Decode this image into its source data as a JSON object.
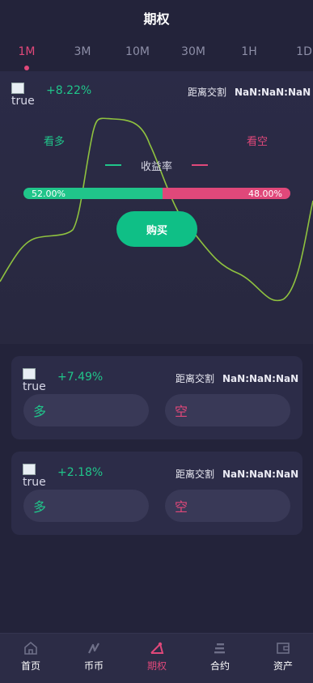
{
  "header": {
    "title": "期权"
  },
  "tabs": {
    "items": [
      "1M",
      "3M",
      "10M",
      "30M",
      "1H",
      "1D"
    ],
    "active": "1M"
  },
  "hero": {
    "image_alt": "true",
    "change": "+8.22%",
    "countdown_label": "距离交割",
    "countdown_value": "NaN:NaN:NaN",
    "long_label": "看多",
    "short_label": "看空",
    "yield_label": "收益率",
    "long_ratio": 0.52,
    "long_pct": "52.00%",
    "short_pct": "48.00%",
    "buy_label": "购买"
  },
  "cards": [
    {
      "image_alt": "true",
      "change": "+7.49%",
      "countdown_label": "距离交割",
      "countdown_value": "NaN:NaN:NaN",
      "long_label": "多",
      "short_label": "空"
    },
    {
      "image_alt": "true",
      "change": "+2.18%",
      "countdown_label": "距离交割",
      "countdown_value": "NaN:NaN:NaN",
      "long_label": "多",
      "short_label": "空"
    }
  ],
  "nav": {
    "items": [
      {
        "label": "首页",
        "icon": "home-icon"
      },
      {
        "label": "币币",
        "icon": "trade-icon"
      },
      {
        "label": "期权",
        "icon": "options-icon"
      },
      {
        "label": "合约",
        "icon": "contract-icon"
      },
      {
        "label": "资产",
        "icon": "wallet-icon"
      }
    ],
    "active": "期权"
  },
  "colors": {
    "background": "#23233a",
    "up": "#20c58a",
    "down": "#e0487a",
    "accent": "#e0487a",
    "curve": "#8fc23f"
  }
}
